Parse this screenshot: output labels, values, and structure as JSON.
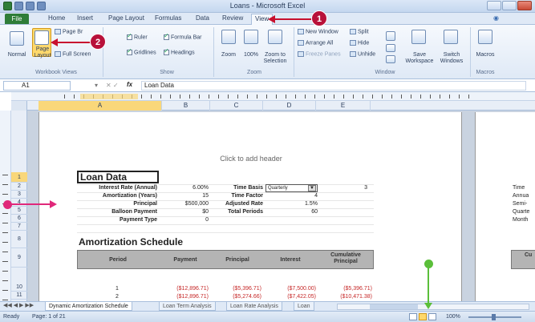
{
  "window": {
    "title": "Loans - Microsoft Excel"
  },
  "tabs": [
    {
      "label": "Home"
    },
    {
      "label": "Insert"
    },
    {
      "label": "Page Layout"
    },
    {
      "label": "Formulas"
    },
    {
      "label": "Data"
    },
    {
      "label": "Review"
    },
    {
      "label": "View"
    }
  ],
  "file_tab": "File",
  "ribbon": {
    "workbook_views": {
      "normal": "Normal",
      "page_layout": "Page\nLayout",
      "page_break": "Page Br",
      "full_screen": "Full Screen",
      "group_label": "Workbook Views"
    },
    "show": {
      "ruler": "Ruler",
      "formula_bar": "Formula Bar",
      "gridlines": "Gridlines",
      "headings": "Headings",
      "group_label": "Show"
    },
    "zoom": {
      "zoom": "Zoom",
      "hundred": "100%",
      "to_selection": "Zoom to\nSelection",
      "group_label": "Zoom"
    },
    "window": {
      "new_window": "New Window",
      "arrange_all": "Arrange All",
      "freeze_panes": "Freeze Panes",
      "split": "Split",
      "hide": "Hide",
      "unhide": "Unhide",
      "save_workspace": "Save\nWorkspace",
      "switch_windows": "Switch\nWindows",
      "group_label": "Window"
    },
    "macros": {
      "macros": "Macros",
      "group_label": "Macros"
    }
  },
  "formula_bar": {
    "name_box": "A1",
    "fx": "fx",
    "content": "Loan Data"
  },
  "columns": [
    {
      "label": "A"
    },
    {
      "label": "B"
    },
    {
      "label": "C"
    },
    {
      "label": "D"
    },
    {
      "label": "E"
    }
  ],
  "rows": [
    "1",
    "2",
    "3",
    "4",
    "5",
    "6",
    "7",
    "8",
    "9",
    "10",
    "11"
  ],
  "sheet": {
    "header_hint": "Click to add header",
    "loan_title": "Loan Data",
    "left_labels": [
      {
        "label": "Interest Rate (Annual)",
        "value": "6.00%"
      },
      {
        "label": "Amortization (Years)",
        "value": "15"
      },
      {
        "label": "Principal",
        "value": "$500,000"
      },
      {
        "label": "Balloon Payment",
        "value": "$0"
      },
      {
        "label": "Payment Type",
        "value": "0"
      }
    ],
    "right_labels": [
      {
        "label": "Time Basis",
        "value": "Quarterly"
      },
      {
        "label": "Time Factor",
        "value": "4"
      },
      {
        "label": "Adjusted Rate",
        "value": "1.5%"
      },
      {
        "label": "Total Periods",
        "value": "60"
      }
    ],
    "extra_value": "3",
    "amort_title": "Amortization Schedule",
    "table_headers": [
      "Period",
      "Payment",
      "Principal",
      "Interest",
      "Cumulative\nPrincipal"
    ],
    "table_rows": [
      [
        "1",
        "($12,896.71)",
        "($5,396.71)",
        "($7,500.00)",
        "($5,396.71)"
      ],
      [
        "2",
        "($12,896.71)",
        "($5,274.66)",
        "($7,422.05)",
        "($10,471.38)"
      ]
    ],
    "page2_labels": [
      "Time",
      "Annua",
      "Semi-",
      "Quarte",
      "Month"
    ],
    "page2_header": "Cu"
  },
  "sheet_tabs": [
    {
      "label": "Dynamic Amortization Schedule"
    },
    {
      "label": "Loan Term Analysis"
    },
    {
      "label": "Loan Rate Analysis"
    },
    {
      "label": "Loan"
    }
  ],
  "status": {
    "ready": "Ready",
    "page": "Page: 1 of 21",
    "zoom": "100%"
  },
  "callouts": {
    "one": "1",
    "two": "2"
  },
  "colors": {
    "callout": "#b8113a",
    "arrow": "#c8102e",
    "green_marker": "#5bbf3a",
    "pink_marker": "#e0287a",
    "file_tab": "#2f7d38",
    "selection": "#f9d77a"
  }
}
